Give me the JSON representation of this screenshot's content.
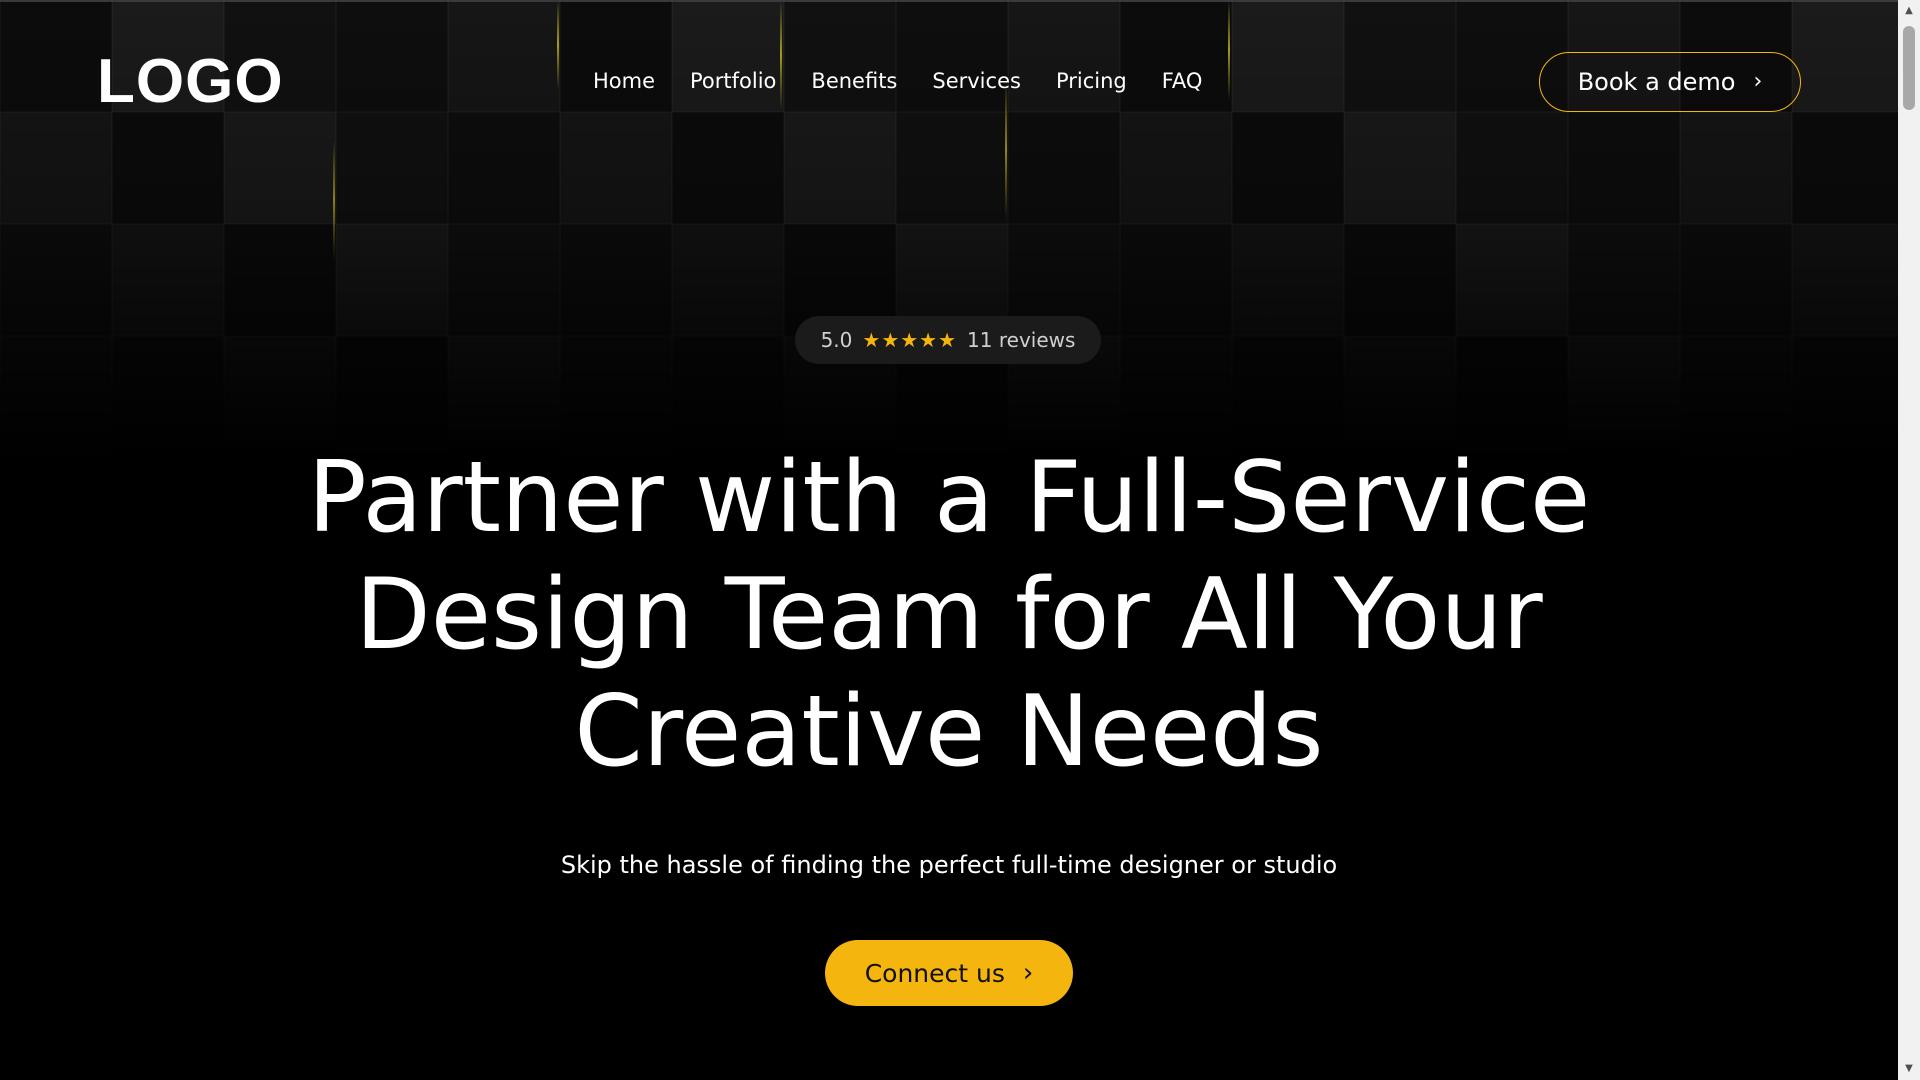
{
  "header": {
    "logo": "LOGO",
    "nav": [
      "Home",
      "Portfolio",
      "Benefits",
      "Services",
      "Pricing",
      "FAQ"
    ],
    "cta_label": "Book a demo",
    "cta_icon": "chevron-right-icon"
  },
  "rating": {
    "score": "5.0",
    "stars": 5,
    "stars_text": "★★★★★",
    "reviews": "11 reviews"
  },
  "hero": {
    "title_lines": [
      "Partner with a Full-Service",
      "Design Team for All Your",
      "Creative Needs"
    ],
    "subtitle": "Skip the hassle of finding the perfect full-time designer or studio",
    "cta_label": "Connect us",
    "cta_icon": "chevron-right-icon"
  },
  "colors": {
    "accent": "#f5b50f",
    "background": "#000000",
    "text": "#ffffff"
  }
}
